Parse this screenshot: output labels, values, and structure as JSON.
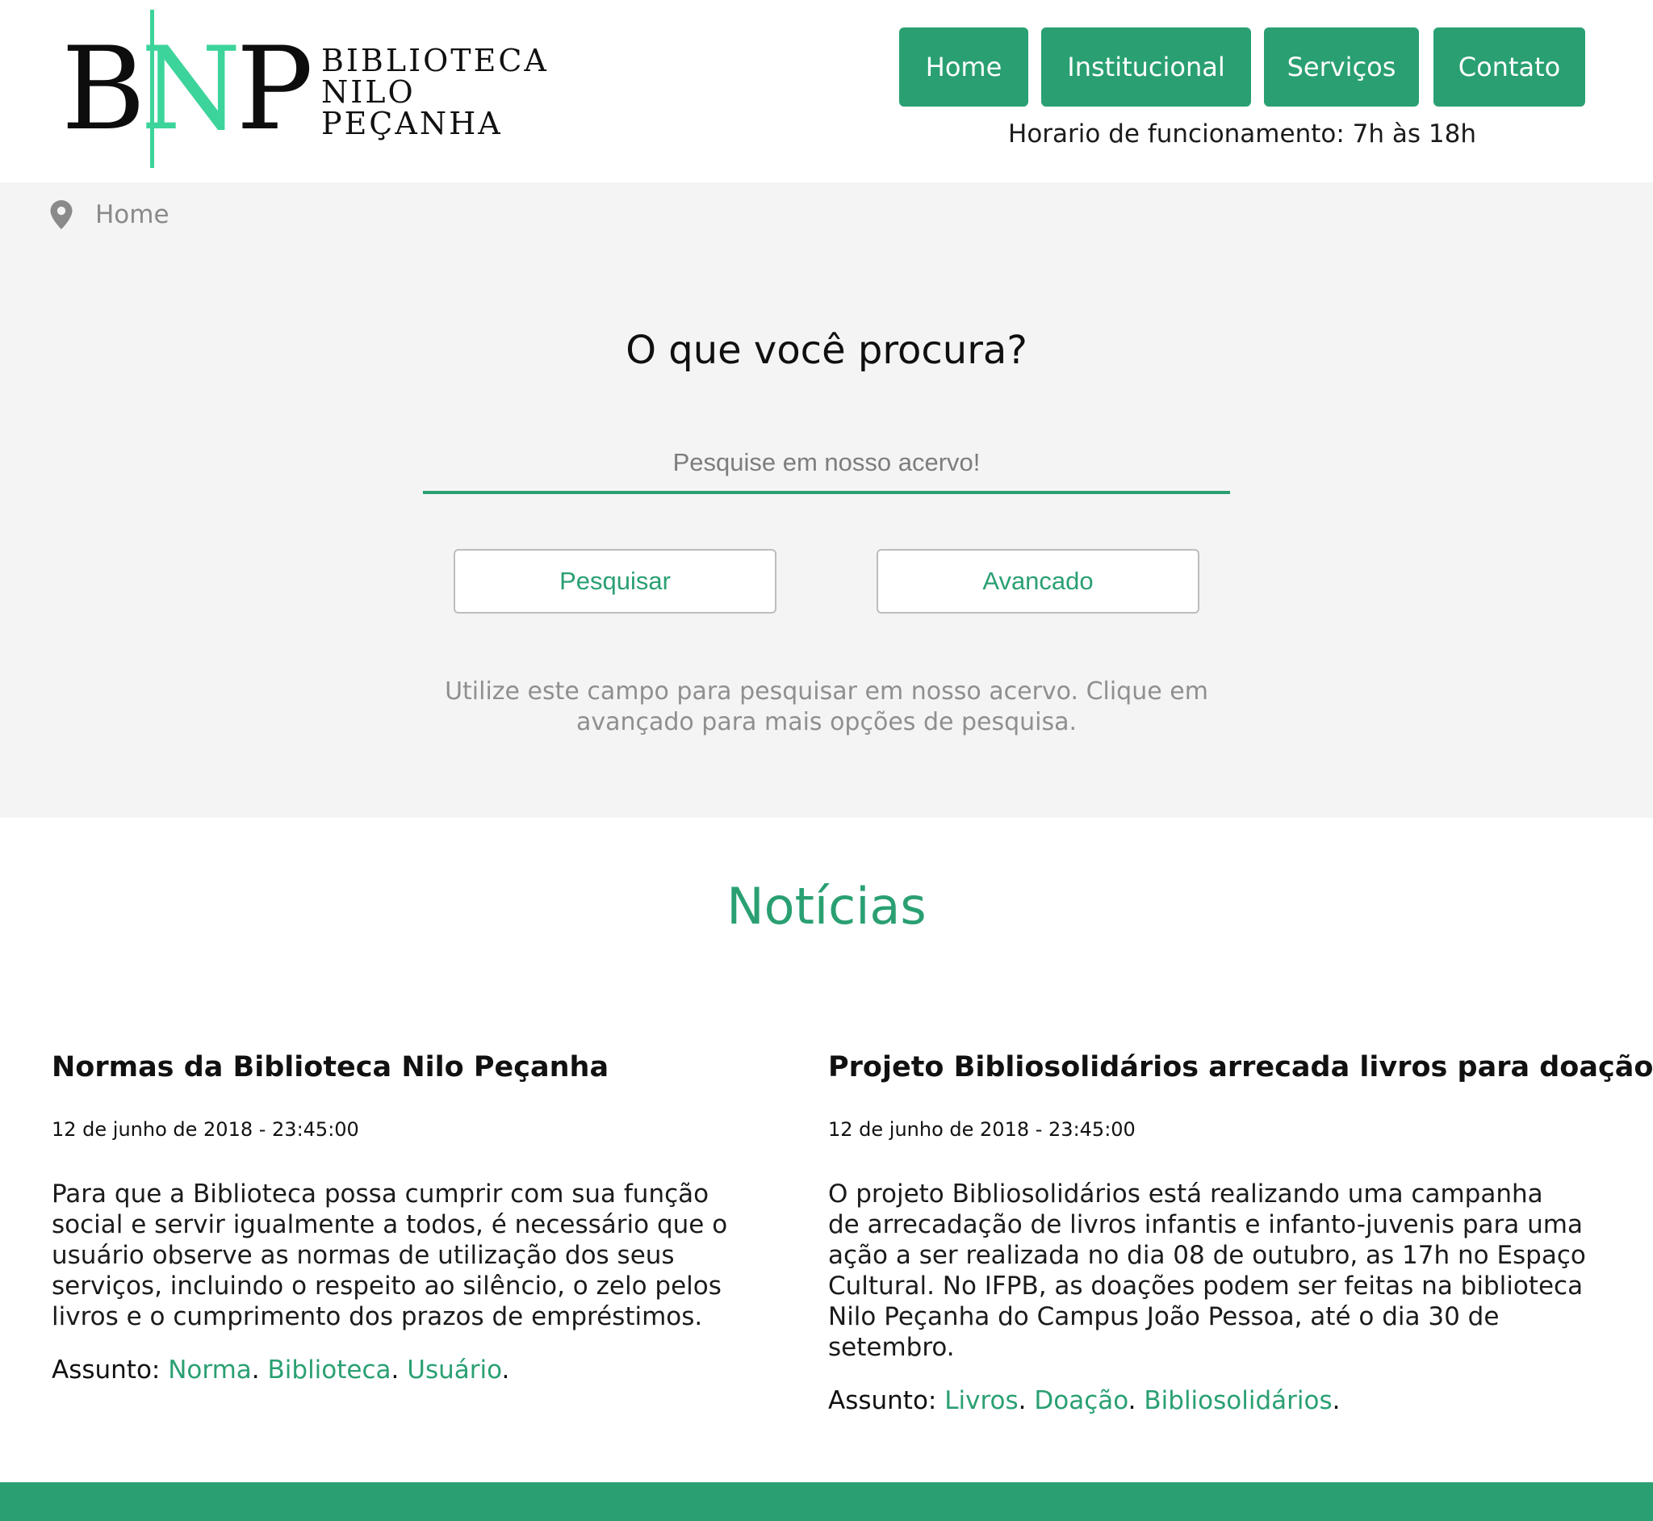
{
  "header": {
    "logo": {
      "monogram_b": "B",
      "monogram_n": "N",
      "monogram_p": "P",
      "wordmark_lines": [
        "BIBLIOTECA",
        "NILO",
        "PEÇANHA"
      ]
    },
    "nav": [
      {
        "label": "Home"
      },
      {
        "label": "Institucional"
      },
      {
        "label": "Serviços"
      },
      {
        "label": "Contato"
      }
    ],
    "hours": "Horario de funcionamento: 7h às 18h"
  },
  "breadcrumb": {
    "icon": "map-pin-icon",
    "items": [
      "Home"
    ]
  },
  "search": {
    "title": "O que você procura?",
    "placeholder": "Pesquise em nosso acervo!",
    "value": "",
    "search_button": "Pesquisar",
    "advanced_button": "Avancado",
    "help_line1": "Utilize este campo para pesquisar em nosso acervo. Clique em",
    "help_line2": "avançado para mais opções de pesquisa."
  },
  "news": {
    "title": "Notícias",
    "subject_label": "Assunto:",
    "items": [
      {
        "title": "Normas da Biblioteca Nilo Peçanha",
        "date": "12 de junho de 2018 - 23:45:00",
        "body": "Para que a Biblioteca possa cumprir com sua função\nsocial e servir igualmente a todos, é necessário que o\nusuário observe as normas de utilização dos seus\nserviços, incluindo o respeito ao silêncio, o zelo pelos\nlivros e o cumprimento dos prazos de empréstimos.",
        "tags": [
          "Norma",
          "Biblioteca",
          "Usuário"
        ]
      },
      {
        "title": "Projeto Bibliosolidários arrecada livros para doação",
        "date": "12 de junho de 2018 - 23:45:00",
        "body": "O projeto Bibliosolidários está realizando uma campanha\nde arrecadação de livros infantis e infanto-juvenis para uma\nação a ser realizada no dia 08 de outubro, as 17h no Espaço\nCultural. No IFPB, as doações podem ser feitas na biblioteca\nNilo Peçanha do Campus João Pessoa, até o dia 30 de\nsetembro.",
        "tags": [
          "Livros",
          "Doação",
          "Bibliosolidários"
        ]
      }
    ]
  },
  "colors": {
    "accent": "#2aa072",
    "logo_green": "#3cd49a",
    "band_bg": "#f4f4f4",
    "muted_text": "#8f8f8f"
  }
}
